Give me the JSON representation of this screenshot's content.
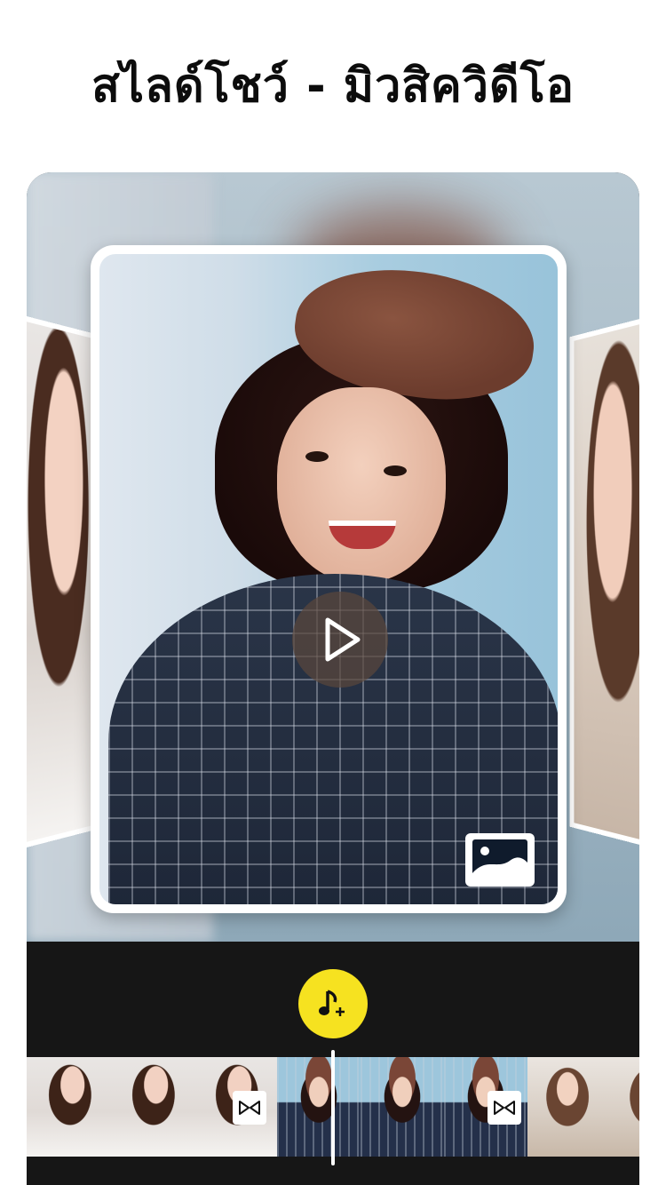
{
  "headline": "สไลด์โชว์ - มิวสิควิดีโอ",
  "preview": {
    "play_icon": "play-icon",
    "gallery_icon": "image-gallery-icon"
  },
  "controls": {
    "music_icon": "add-music-icon"
  },
  "timeline": {
    "transition_icon": "transition-bowtie-icon",
    "thumbnails": [
      "clip-1",
      "clip-1",
      "clip-1",
      "clip-2",
      "clip-2",
      "clip-2",
      "clip-3",
      "clip-3"
    ]
  },
  "colors": {
    "accent_yellow": "#f6e220",
    "editor_background": "#161616",
    "headline_text": "#0c0c0c"
  }
}
